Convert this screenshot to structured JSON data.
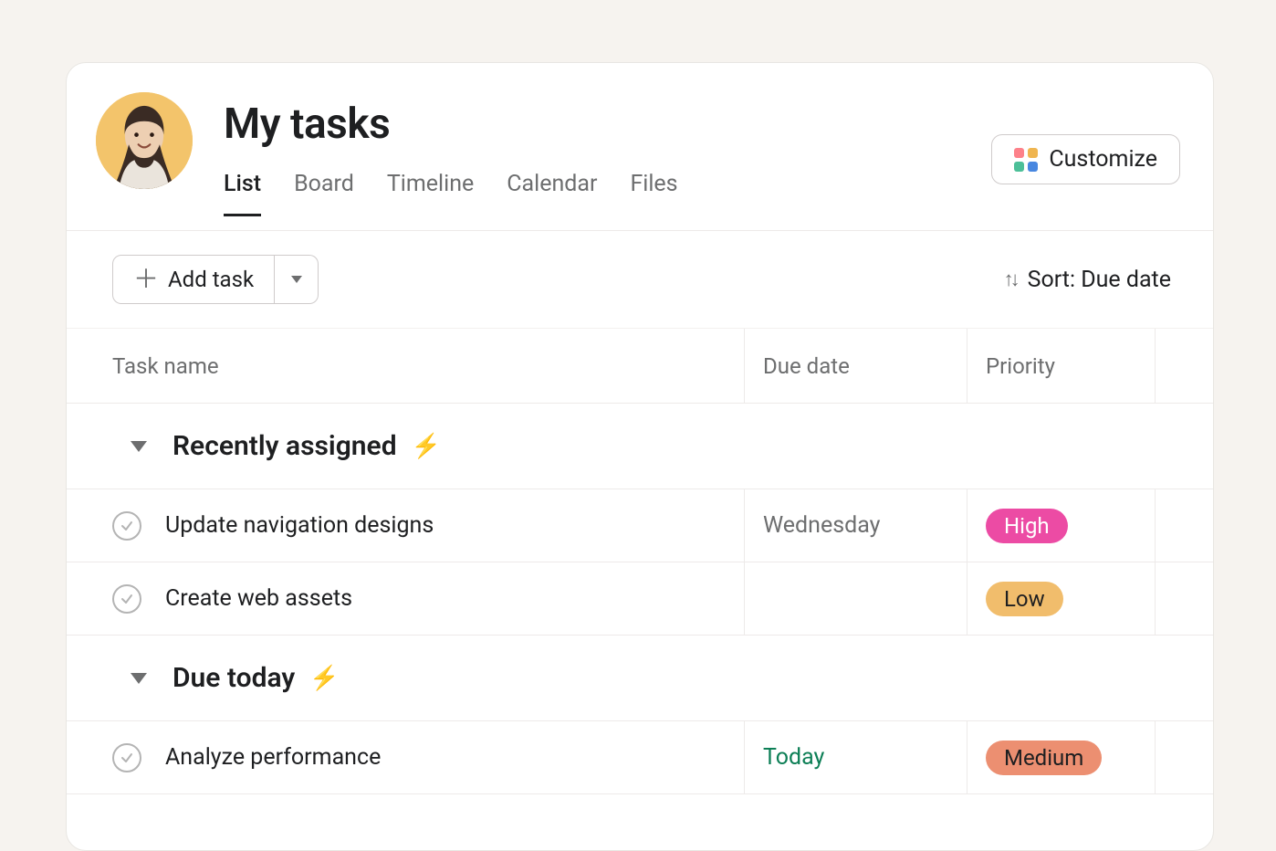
{
  "header": {
    "title": "My tasks",
    "tabs": [
      "List",
      "Board",
      "Timeline",
      "Calendar",
      "Files"
    ],
    "active_tab_index": 0,
    "customize_label": "Customize"
  },
  "toolbar": {
    "add_task_label": "Add task",
    "sort_label": "Sort: Due date"
  },
  "columns": {
    "name": "Task name",
    "due": "Due date",
    "priority": "Priority"
  },
  "sections": [
    {
      "title": "Recently assigned",
      "tasks": [
        {
          "name": "Update navigation designs",
          "due": "Wednesday",
          "due_class": "",
          "priority": "High",
          "priority_class": "pill-high"
        },
        {
          "name": "Create web assets",
          "due": "",
          "due_class": "",
          "priority": "Low",
          "priority_class": "pill-low"
        }
      ]
    },
    {
      "title": "Due today",
      "tasks": [
        {
          "name": "Analyze performance",
          "due": "Today",
          "due_class": "today",
          "priority": "Medium",
          "priority_class": "pill-medium"
        }
      ]
    }
  ]
}
